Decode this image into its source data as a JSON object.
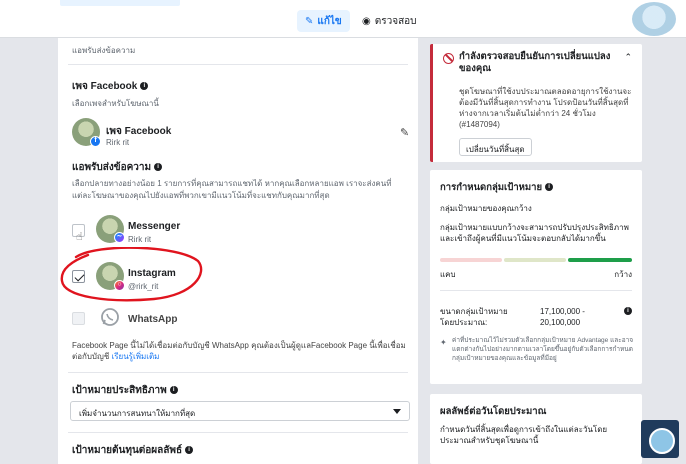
{
  "topbar": {
    "edit_label": "แก้ไข",
    "review_label": "ตรวจสอบ"
  },
  "messaging_app_header": {
    "subtitle": "แอพรับส่งข้อความ"
  },
  "facebook_page": {
    "title": "เพจ Facebook",
    "subtitle": "เลือกเพจสำหรับโฆษณานี้",
    "page_name": "เพจ Facebook",
    "page_owner": "Rirk rit"
  },
  "messaging_apps": {
    "title": "แอพรับส่งข้อความ",
    "description": "เลือกปลายทางอย่างน้อย 1 รายการที่คุณสามารถแชทได้ หากคุณเลือกหลายแอพ เราจะส่งคนที่แต่ละโฆษณาของคุณไปยังแอพที่พวกเขามีแนวโน้มที่จะแชทกับคุณมากที่สุด",
    "apps": [
      {
        "name": "Messenger",
        "account": "Rirk rit",
        "checked": false
      },
      {
        "name": "Instagram",
        "account": "@rirk_rit",
        "checked": true
      },
      {
        "name": "WhatsApp",
        "account": "",
        "checked": false
      }
    ],
    "whatsapp_note": "Facebook Page นี้ไม่ได้เชื่อมต่อกับบัญชี WhatsApp คุณต้องเป็นผู้ดูแลFacebook Page นี้เพื่อเชื่อมต่อกับบัญชี",
    "learn_more": "เรียนรู้เพิ่มเติม"
  },
  "performance_goal": {
    "title": "เป้าหมายประสิทธิภาพ",
    "selected": "เพิ่มจำนวนการสนทนาให้มากที่สุด"
  },
  "cost_per_result": {
    "title": "เป้าหมายต้นทุนต่อผลลัพธ์"
  },
  "pending_card": {
    "title": "กำลังตรวจสอบยืนยันการเปลี่ยนแปลงของคุณ",
    "body": "ชุดโฆษณาที่ใช้งบประมาณตลอดอายุการใช้งานจะต้องมีวันที่สิ้นสุดการทำงาน โปรดป้อนวันที่สิ้นสุดที่ห่างจากเวลาเริ่มต้นไม่ต่ำกว่า 24 ชั่วโมง (#1487094)",
    "button": "เปลี่ยนวันที่สิ้นสุด"
  },
  "audience_card": {
    "title": "การกำหนดกลุ่มเป้าหมาย",
    "subtitle": "กลุ่มเป้าหมายของคุณกว้าง",
    "description": "กลุ่มเป้าหมายแบบกว้างจะสามารถปรับปรุงประสิทธิภาพและเข้าถึงผู้คนที่มีแนวโน้มจะตอบกลับได้มากขึ้น",
    "narrow_label": "แคบ",
    "broad_label": "กว้าง",
    "size_label": "ขนาดกลุ่มเป้าหมายโดยประมาณ:",
    "size_value": "17,100,000 - 20,100,000",
    "note": "ค่าที่ประมาณไว้ไม่รวมตัวเลือกกลุ่มเป้าหมาย Advantage และอาจแตกต่างกันไปอย่างมากตามเวลาโดยขึ้นอยู่กับตัวเลือกการกำหนดกลุ่มเป้าหมายของคุณและข้อมูลที่มีอยู่"
  },
  "results_card": {
    "title": "ผลลัพธ์ต่อวันโดยประมาณ",
    "description": "กำหนดวันที่สิ้นสุดเพื่อดูการเข้าถึงในแต่ละวันโดยประมาณสำหรับชุดโฆษณานี้"
  },
  "colors": {
    "accent": "#1877f2",
    "error": "#c42b3b",
    "annotation": "#e0141e",
    "meter_narrow": "#f7d4d4",
    "meter_mid": "#dfe6c8",
    "meter_broad": "#1e9e4a"
  }
}
